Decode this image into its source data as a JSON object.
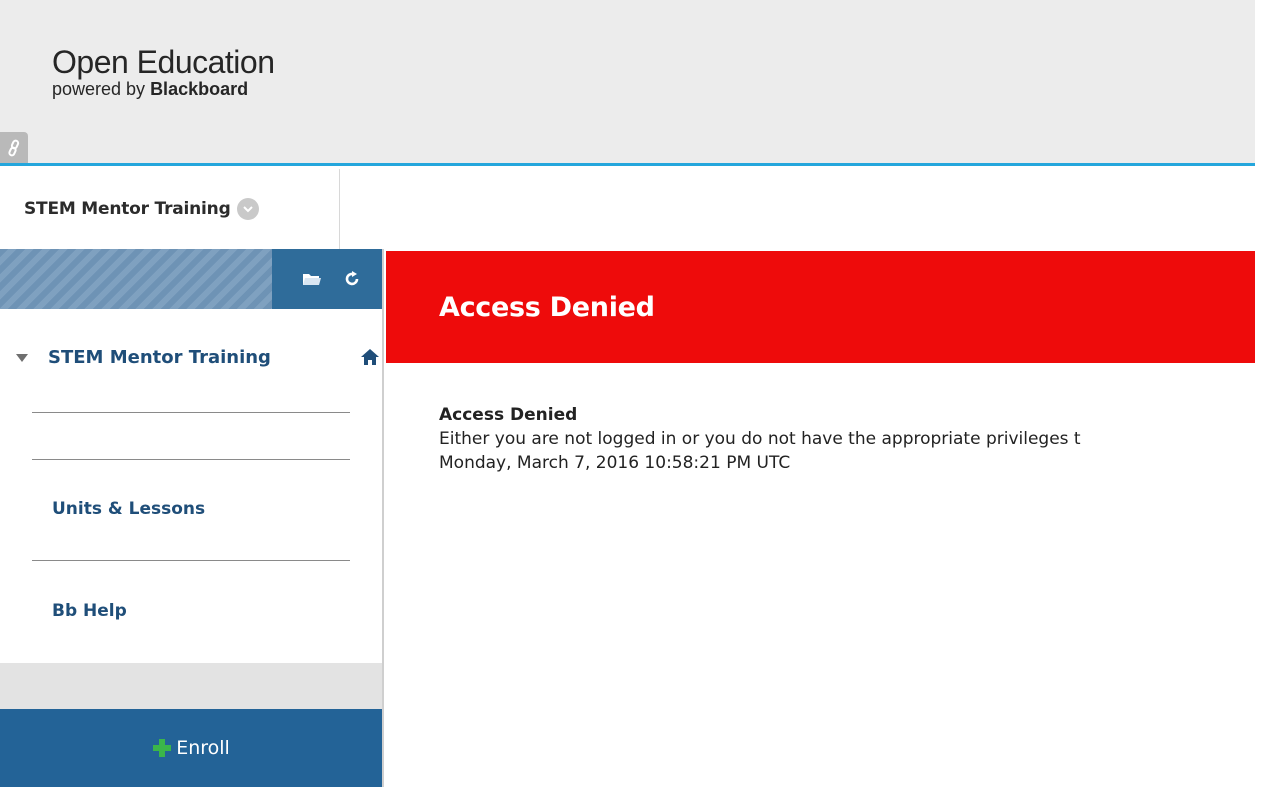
{
  "header": {
    "brand_title": "Open Education",
    "brand_sub_prefix": "powered by ",
    "brand_sub_bold": "Blackboard",
    "link_icon": "link-icon",
    "accent_color": "#24a6dc"
  },
  "coursebar": {
    "course_name": "STEM Mentor Training",
    "chevron_icon": "chevron-down-icon"
  },
  "sidebar": {
    "tools": [
      {
        "icon": "folder-icon"
      },
      {
        "icon": "refresh-icon"
      }
    ],
    "course_link": "STEM Mentor Training",
    "items": [
      {
        "label": "Units & Lessons"
      },
      {
        "label": "Bb Help"
      }
    ],
    "enroll_label": "Enroll",
    "enroll_color": "#236397"
  },
  "content": {
    "banner_title": "Access Denied",
    "banner_color": "#ee0b0b",
    "message_title": "Access Denied",
    "message_body": "Either you are not logged in or you do not have the appropriate privileges t",
    "timestamp": "Monday, March 7, 2016 10:58:21 PM UTC"
  }
}
